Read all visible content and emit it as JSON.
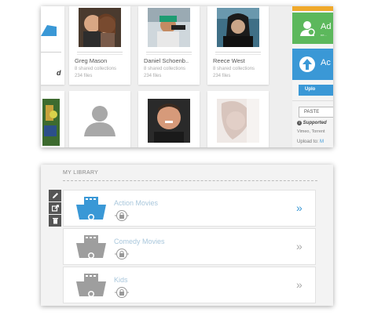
{
  "people": [
    {
      "name": "Greg Mason",
      "collections": "8 shared collections",
      "files": "234 files"
    },
    {
      "name": "Daniel Schoenb..",
      "collections": "8 shared collections",
      "files": "234 files"
    },
    {
      "name": "Reece West",
      "collections": "8 shared collections",
      "files": "234 files"
    }
  ],
  "sidebar_right": {
    "add_label": "Ad",
    "add_sub": "ne...",
    "action_label": "Ac",
    "upload_label": "Uplo",
    "paste_label": "PASTE",
    "supported_label": "Supported",
    "supported_list": "Vimeo, Torrent",
    "upload_to_label": "Upload to:",
    "upload_to_value": "M"
  },
  "left_fragment": "d",
  "library": {
    "title": "MY LIBRARY",
    "tools": [
      "pencil-icon",
      "share-icon",
      "trash-icon"
    ],
    "rows": [
      {
        "name": "Action Movies",
        "active": true
      },
      {
        "name": "Comedy Movies",
        "active": false
      },
      {
        "name": "Kids",
        "active": false
      }
    ],
    "chevron": "»"
  },
  "colors": {
    "accent_blue": "#3a98d6",
    "accent_green": "#5cb85c",
    "gray_icon": "#9e9e9e"
  }
}
